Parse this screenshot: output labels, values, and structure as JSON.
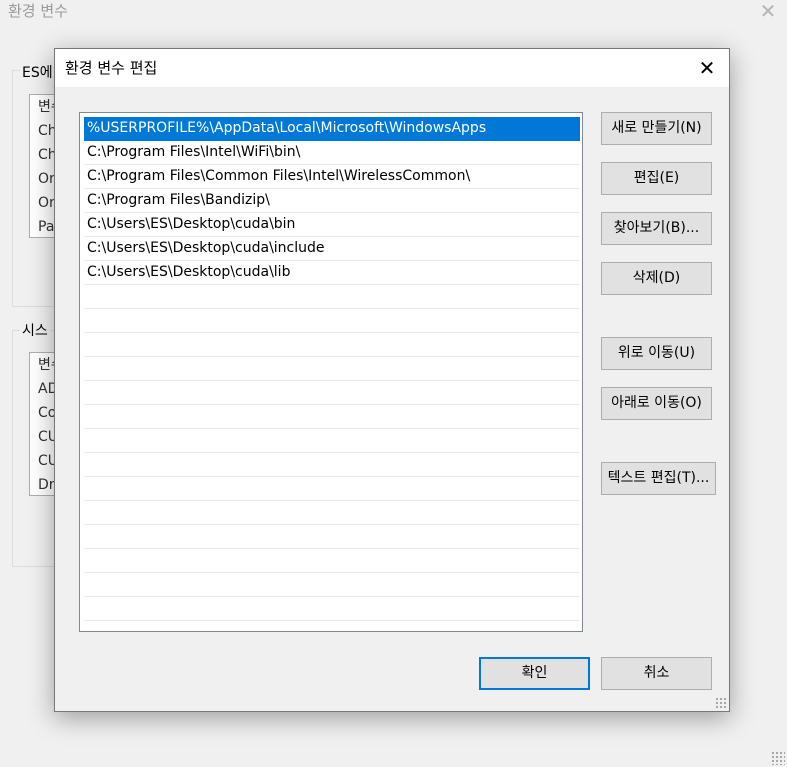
{
  "background_window": {
    "title": "환경 변수",
    "close_glyph": "✕",
    "user_group_label": "ES에",
    "user_vars": [
      "변수",
      "Ch",
      "Ch",
      "On",
      "On",
      "Pa"
    ],
    "system_group_label": "시스",
    "system_vars": [
      "변수",
      "AD",
      "Co",
      "CU",
      "CU",
      "Dr"
    ]
  },
  "dialog": {
    "title": "환경 변수 편집",
    "close_glyph": "✕",
    "paths": [
      "%USERPROFILE%\\AppData\\Local\\Microsoft\\WindowsApps",
      "C:\\Program Files\\Intel\\WiFi\\bin\\",
      "C:\\Program Files\\Common Files\\Intel\\WirelessCommon\\",
      "C:\\Program Files\\Bandizip\\",
      "C:\\Users\\ES\\Desktop\\cuda\\bin",
      "C:\\Users\\ES\\Desktop\\cuda\\include",
      "C:\\Users\\ES\\Desktop\\cuda\\lib"
    ],
    "buttons": {
      "new": "새로 만들기(N)",
      "edit": "편집(E)",
      "browse": "찾아보기(B)...",
      "delete": "삭제(D)",
      "move_up": "위로 이동(U)",
      "move_down": "아래로 이동(O)",
      "edit_text": "텍스트 편집(T)...",
      "ok": "확인",
      "cancel": "취소"
    }
  },
  "colors": {
    "selection": "#0078d7",
    "button_face": "#e1e1e1",
    "window_bg": "#f0f0f0"
  }
}
